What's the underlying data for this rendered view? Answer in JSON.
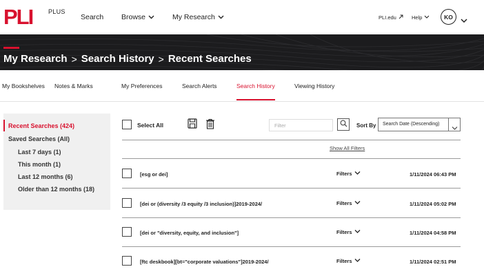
{
  "brand": {
    "logo": "PLI",
    "plus": "PLUS"
  },
  "topnav": {
    "search": "Search",
    "browse": "Browse",
    "my_research": "My Research",
    "pli_edu": "PLI.edu",
    "help": "Help",
    "avatar": "KO"
  },
  "breadcrumb": [
    "My Research",
    "Search History",
    "Recent Searches"
  ],
  "breadcrumb_sep": ">",
  "subnav": [
    "My Bookshelves",
    "Notes & Marks",
    "My Preferences",
    "Search Alerts",
    "Search History",
    "Viewing History"
  ],
  "sidebar": {
    "recent": "Recent Searches (424)",
    "saved": "Saved Searches (All)",
    "items": [
      "Last 7 days (1)",
      "This month (1)",
      "Last 12 months (6)",
      "Older than 12 months (18)"
    ]
  },
  "toolbar": {
    "select_all": "Select All",
    "filter_placeholder": "Filter",
    "sort_by": "Sort By",
    "sort_value": "Search Date (Descending)",
    "show_all_filters": "Show All Filters"
  },
  "rows": [
    {
      "query": "[esg or dei]",
      "filters": "Filters",
      "date": "1/11/2024 06:43 PM"
    },
    {
      "query": "[dei or (diversity /3 equity /3 inclusion)]2019-2024/",
      "filters": "Filters",
      "date": "1/11/2024 05:02 PM"
    },
    {
      "query": "[dei or \"diversity, equity, and inclusion\"]",
      "filters": "Filters",
      "date": "1/11/2024 04:58 PM"
    },
    {
      "query": "[ftc deskbook][bt=\"corporate valuations\"]2019-2024/",
      "filters": "Filters",
      "date": "1/11/2024 02:51 PM"
    }
  ],
  "colors": {
    "accent": "#d8112e",
    "banner": "#1c1c1e",
    "sidebar": "#f0f0f0"
  }
}
